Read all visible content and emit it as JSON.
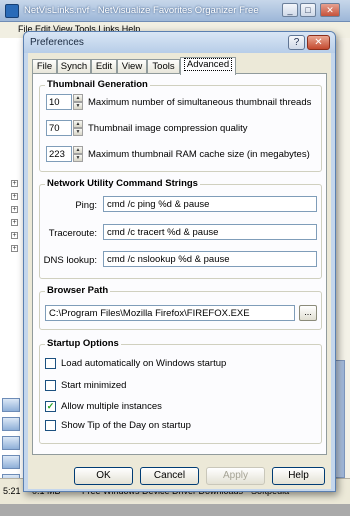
{
  "background_window": {
    "title": "NetVisLinks.nvf - NetVisualize Favorites Organizer Free",
    "menu_partial": "File  Edit  View  Tools  Links  Help",
    "status": {
      "part1": "5:21",
      "part2": "0.1 MB",
      "part3": "Free Windows Device Driver Downloads - Softpedia"
    }
  },
  "dialog": {
    "title": "Preferences",
    "help_glyph": "?",
    "close_glyph": "✕"
  },
  "tabs": [
    {
      "label": "File"
    },
    {
      "label": "Synch"
    },
    {
      "label": "Edit"
    },
    {
      "label": "View"
    },
    {
      "label": "Tools"
    },
    {
      "label": "Advanced",
      "active": true
    }
  ],
  "thumbnail": {
    "title": "Thumbnail Generation",
    "threads": {
      "value": "10",
      "label": "Maximum number of simultaneous thumbnail threads"
    },
    "quality": {
      "value": "70",
      "label": "Thumbnail image compression quality"
    },
    "cache": {
      "value": "223",
      "label": "Maximum thumbnail RAM cache size (in megabytes)"
    }
  },
  "network": {
    "title": "Network Utility Command Strings",
    "ping": {
      "label": "Ping:",
      "value": "cmd /c ping %d & pause"
    },
    "traceroute": {
      "label": "Traceroute:",
      "value": "cmd /c tracert %d & pause"
    },
    "dns": {
      "label": "DNS lookup:",
      "value": "cmd /c nslookup %d & pause"
    }
  },
  "browser": {
    "title": "Browser Path",
    "path": "C:\\Program Files\\Mozilla Firefox\\FIREFOX.EXE",
    "browse_label": "..."
  },
  "startup": {
    "title": "Startup Options",
    "options": [
      {
        "label": "Load automatically on Windows startup",
        "checked": false
      },
      {
        "label": "Start minimized",
        "checked": false
      },
      {
        "label": "Allow multiple instances",
        "checked": true
      },
      {
        "label": "Show Tip of the Day on startup",
        "checked": false
      }
    ]
  },
  "buttons": {
    "ok": "OK",
    "cancel": "Cancel",
    "apply": "Apply",
    "help": "Help"
  }
}
